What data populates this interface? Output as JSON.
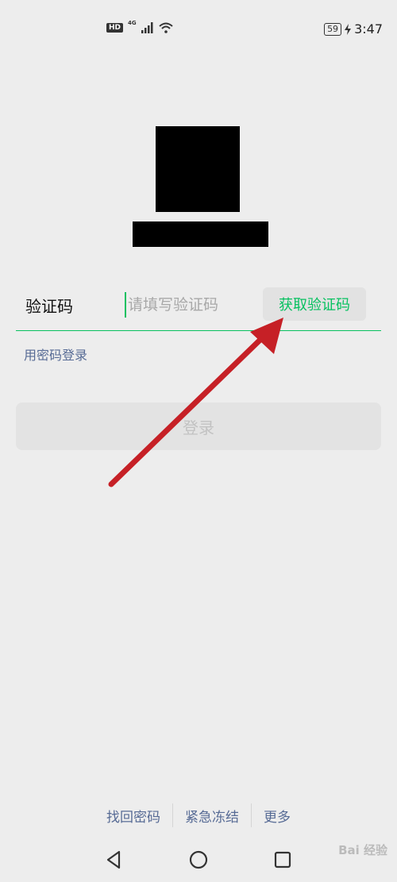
{
  "status_bar": {
    "hd_badge": "HD",
    "network": "4G",
    "battery": "59",
    "time": "3:47"
  },
  "form": {
    "code_label": "验证码",
    "code_placeholder": "请填写验证码",
    "get_code_label": "获取验证码",
    "password_login_link": "用密码登录",
    "login_label": "登录"
  },
  "footer": {
    "links": [
      "找回密码",
      "紧急冻结",
      "更多"
    ]
  },
  "watermark": "Bai 经验",
  "colors": {
    "accent": "#07c160",
    "link": "#576b95",
    "annotation_arrow": "#c62026"
  }
}
